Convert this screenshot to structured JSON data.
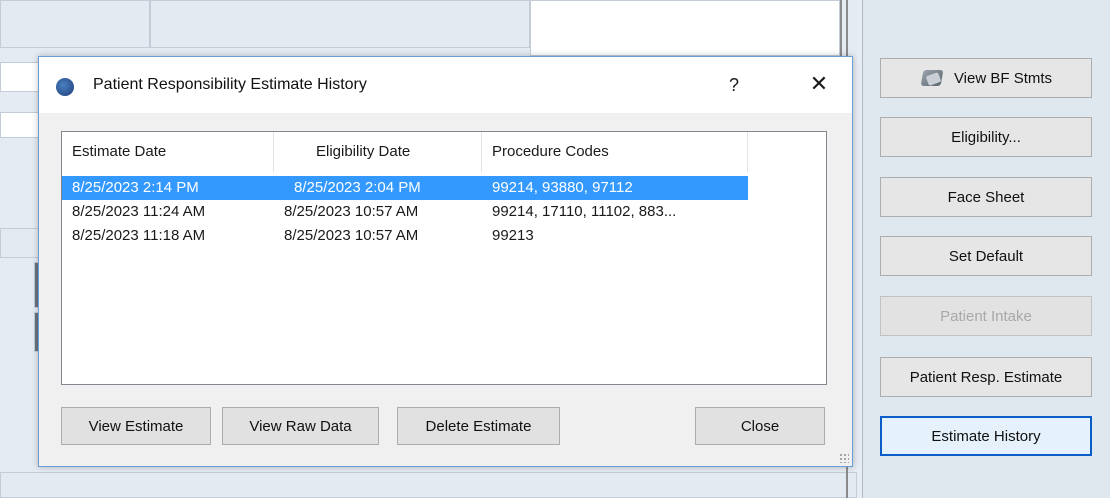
{
  "dialog": {
    "title": "Patient Responsibility Estimate History",
    "help_label": "?",
    "close_glyph": "✕",
    "columns": [
      "Estimate Date",
      "Eligibility Date",
      "Procedure Codes"
    ],
    "rows": [
      {
        "estimate_date": "8/25/2023 2:14 PM",
        "eligibility_date": "8/25/2023 2:04 PM",
        "procedure_codes": "99214, 93880, 97112",
        "selected": true
      },
      {
        "estimate_date": "8/25/2023 11:24 AM",
        "eligibility_date": "8/25/2023 10:57 AM",
        "procedure_codes": "99214, 17110, 11102, 883...",
        "selected": false
      },
      {
        "estimate_date": "8/25/2023 11:18 AM",
        "eligibility_date": "8/25/2023 10:57 AM",
        "procedure_codes": "99213",
        "selected": false
      }
    ],
    "buttons": {
      "view_estimate": "View Estimate",
      "view_raw_data": "View Raw Data",
      "delete_estimate": "Delete Estimate",
      "close": "Close"
    }
  },
  "sidebar": {
    "view_bf_stmts": "View BF Stmts",
    "eligibility": "Eligibility...",
    "face_sheet": "Face Sheet",
    "set_default": "Set Default",
    "patient_intake": "Patient Intake",
    "patient_resp_estimate": "Patient Resp. Estimate",
    "estimate_history": "Estimate History"
  },
  "colors": {
    "selection": "#3399ff",
    "focus_border": "#0a5ec8",
    "dialog_border": "#6b9fd4"
  },
  "icons": {
    "app_icon": "app-globe-icon",
    "bf_icon": "statement-icon"
  }
}
